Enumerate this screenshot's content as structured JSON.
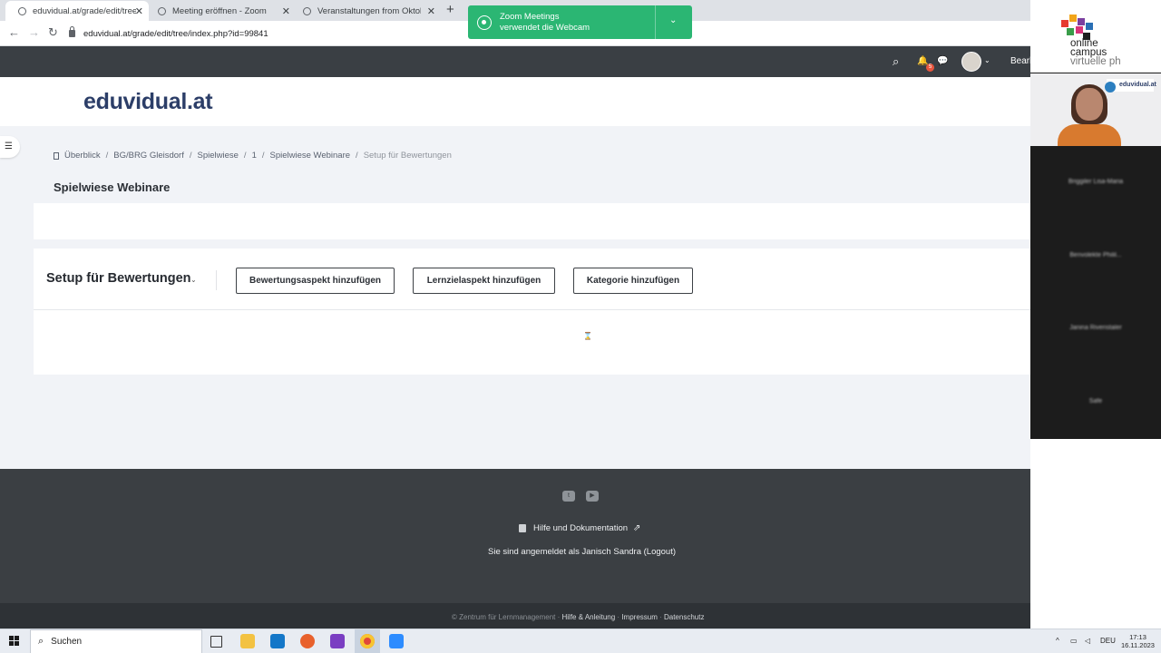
{
  "browser": {
    "tabs": [
      {
        "label": "eduvidual.at/grade/edit/tree/inde",
        "active": true
      },
      {
        "label": "Meeting eröffnen - Zoom",
        "active": false
      },
      {
        "label": "Veranstaltungen from Oktober",
        "active": false
      }
    ],
    "new_tab": "+",
    "close_glyph": "✕",
    "url": "eduvidual.at/grade/edit/tree/index.php?id=99841",
    "nav": {
      "back": "←",
      "forward": "→",
      "reload": "↻"
    }
  },
  "zoom_notification": {
    "line1": "Zoom Meetings",
    "line2": "verwendet die Webcam",
    "chevron": "⌄",
    "color": "#2bb673"
  },
  "moodle_top": {
    "search_icon": "⌕",
    "bell_icon": "🔔",
    "notification_count": "5",
    "chat_icon": "💬",
    "user_chevron": "⌄",
    "username": "Bearb"
  },
  "brand": {
    "name": "eduvidual.at",
    "color": "#2c3e68"
  },
  "breadcrumb": {
    "items": [
      "Überblick",
      "BG/BRG Gleisdorf",
      "Spielwiese",
      "1",
      "Spielwiese Webinare"
    ],
    "current": "Setup für Bewertungen",
    "separator": "/"
  },
  "drawer_icon": "☰",
  "course_title": "Spielwiese Webinare",
  "grader": {
    "title": "Setup für Bewertungen",
    "chevron": "⌄",
    "buttons": [
      {
        "label": "Bewertungsaspekt hinzufügen"
      },
      {
        "label": "Lernzielaspekt hinzufügen"
      },
      {
        "label": "Kategorie hinzufügen"
      }
    ]
  },
  "footer": {
    "social": [
      "twitter-icon",
      "youtube-icon"
    ],
    "help_link": "Hilfe und Dokumentation",
    "external_icon": "⇗",
    "logged_in_text": "Sie sind angemeldet als Janisch Sandra (Logout)"
  },
  "legal": {
    "copyright": "© Zentrum für Lernmanagement",
    "links": [
      "Hilfe & Anleitung",
      "Impressum",
      "Datenschutz"
    ],
    "separator": " · "
  },
  "zoom_panel": {
    "logo_line1": "online",
    "logo_line2": "campus",
    "logo_line3": "virtuelle ph",
    "mini_logo": "eduvidual.at",
    "participants": [
      "Briggiler Lisa-Maria",
      "Benvolekte Philil...",
      "Janina Rivenstaler",
      "Safe"
    ]
  },
  "taskbar": {
    "search_placeholder": "Suchen",
    "language": "DEU",
    "time": "17:13",
    "date": "16.11.2023",
    "tray_chevron": "^"
  }
}
